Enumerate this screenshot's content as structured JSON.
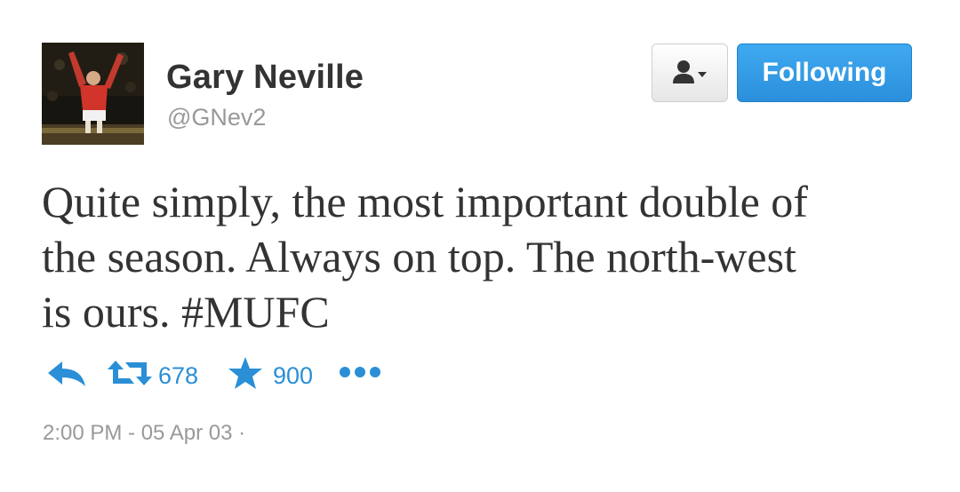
{
  "user": {
    "display_name": "Gary Neville",
    "handle": "@GNev2",
    "avatar_icon": "profile-photo"
  },
  "header_actions": {
    "user_menu_icon": "user-icon",
    "follow_label": "Following",
    "follow_color": "#2b8fdc"
  },
  "tweet": {
    "lines": [
      "Quite simply, the most important double of",
      "the season. Always on top. The north-west",
      "is ours. #MUFC"
    ]
  },
  "actions": {
    "reply_icon": "reply-icon",
    "retweet_icon": "retweet-icon",
    "retweet_count": "678",
    "favorite_icon": "star-icon",
    "favorite_count": "900",
    "more_icon": "more-icon",
    "accent_color": "#2a8fd6"
  },
  "meta": {
    "timestamp": "2:00 PM - 05 Apr 03 ·"
  }
}
